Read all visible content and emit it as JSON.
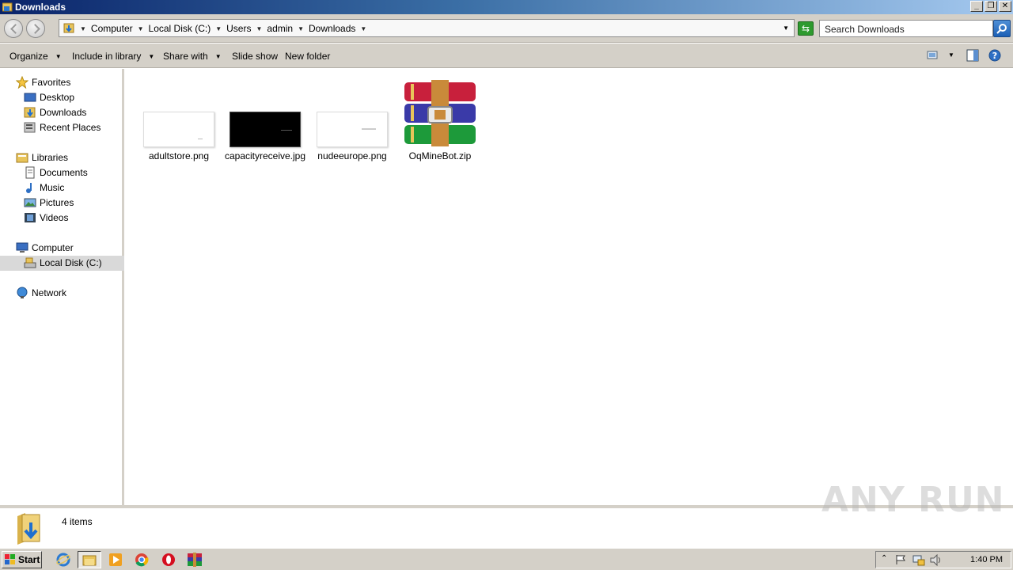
{
  "window": {
    "title": "Downloads",
    "buttons": [
      "minimize",
      "restore",
      "close"
    ]
  },
  "address": {
    "crumbs": [
      "Computer",
      "Local Disk (C:)",
      "Users",
      "admin",
      "Downloads"
    ],
    "search_placeholder": "Search Downloads"
  },
  "toolbar": {
    "organize": "Organize",
    "include_in_library": "Include in library",
    "share_with": "Share with",
    "slide_show": "Slide show",
    "new_folder": "New folder"
  },
  "nav": {
    "favorites": "Favorites",
    "desktop": "Desktop",
    "downloads": "Downloads",
    "recent_places": "Recent Places",
    "libraries": "Libraries",
    "documents": "Documents",
    "music": "Music",
    "pictures": "Pictures",
    "videos": "Videos",
    "computer": "Computer",
    "local_disk": "Local Disk (C:)",
    "network": "Network",
    "selected": "Local Disk (C:)"
  },
  "files": [
    {
      "name": "adultstore.png",
      "kind": "thumbnail-white"
    },
    {
      "name": "capacityreceive.jpg",
      "kind": "thumbnail-black"
    },
    {
      "name": "nudeeurope.png",
      "kind": "thumbnail-white"
    },
    {
      "name": "OqMineBot.zip",
      "kind": "winrar-archive-icon"
    }
  ],
  "status": {
    "item_count": "4 items"
  },
  "watermark": "ANY RUN",
  "taskbar": {
    "start": "Start",
    "apps": [
      "internet-explorer-icon",
      "explorer-folder-icon",
      "media-player-icon",
      "chrome-icon",
      "opera-icon",
      "winrar-icon"
    ],
    "active_app": "explorer-folder-icon",
    "clock": "1:40 PM"
  },
  "colors": {
    "title_bar": "#0a246a",
    "chrome_gray": "#d4d0c8",
    "nav_selected": "#d9d9d9"
  }
}
